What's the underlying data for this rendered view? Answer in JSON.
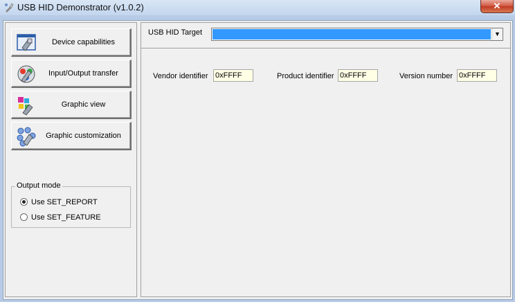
{
  "window": {
    "title": "USB HID Demonstrator (v1.0.2)",
    "close_glyph": "✕"
  },
  "sidebar": {
    "buttons": [
      {
        "label": "Device capabilities",
        "icon": "device-capabilities-icon"
      },
      {
        "label": "Input/Output transfer",
        "icon": "io-transfer-icon"
      },
      {
        "label": "Graphic view",
        "icon": "graphic-view-icon"
      },
      {
        "label": "Graphic customization",
        "icon": "graphic-customization-icon"
      }
    ],
    "output_mode": {
      "title": "Output mode",
      "options": [
        {
          "label": "Use SET_REPORT",
          "checked": true
        },
        {
          "label": "Use SET_FEATURE",
          "checked": false
        }
      ]
    }
  },
  "main": {
    "target_label": "USB HID Target",
    "target_value": "",
    "fields": [
      {
        "label": "Vendor identifier",
        "value": "0xFFFF"
      },
      {
        "label": "Product identifier",
        "value": "0xFFFF"
      },
      {
        "label": "Version number",
        "value": "0xFFFF"
      }
    ]
  },
  "colors": {
    "selection": "#3399ff",
    "field_bg": "#ffffe6",
    "close": "#c03a22"
  }
}
